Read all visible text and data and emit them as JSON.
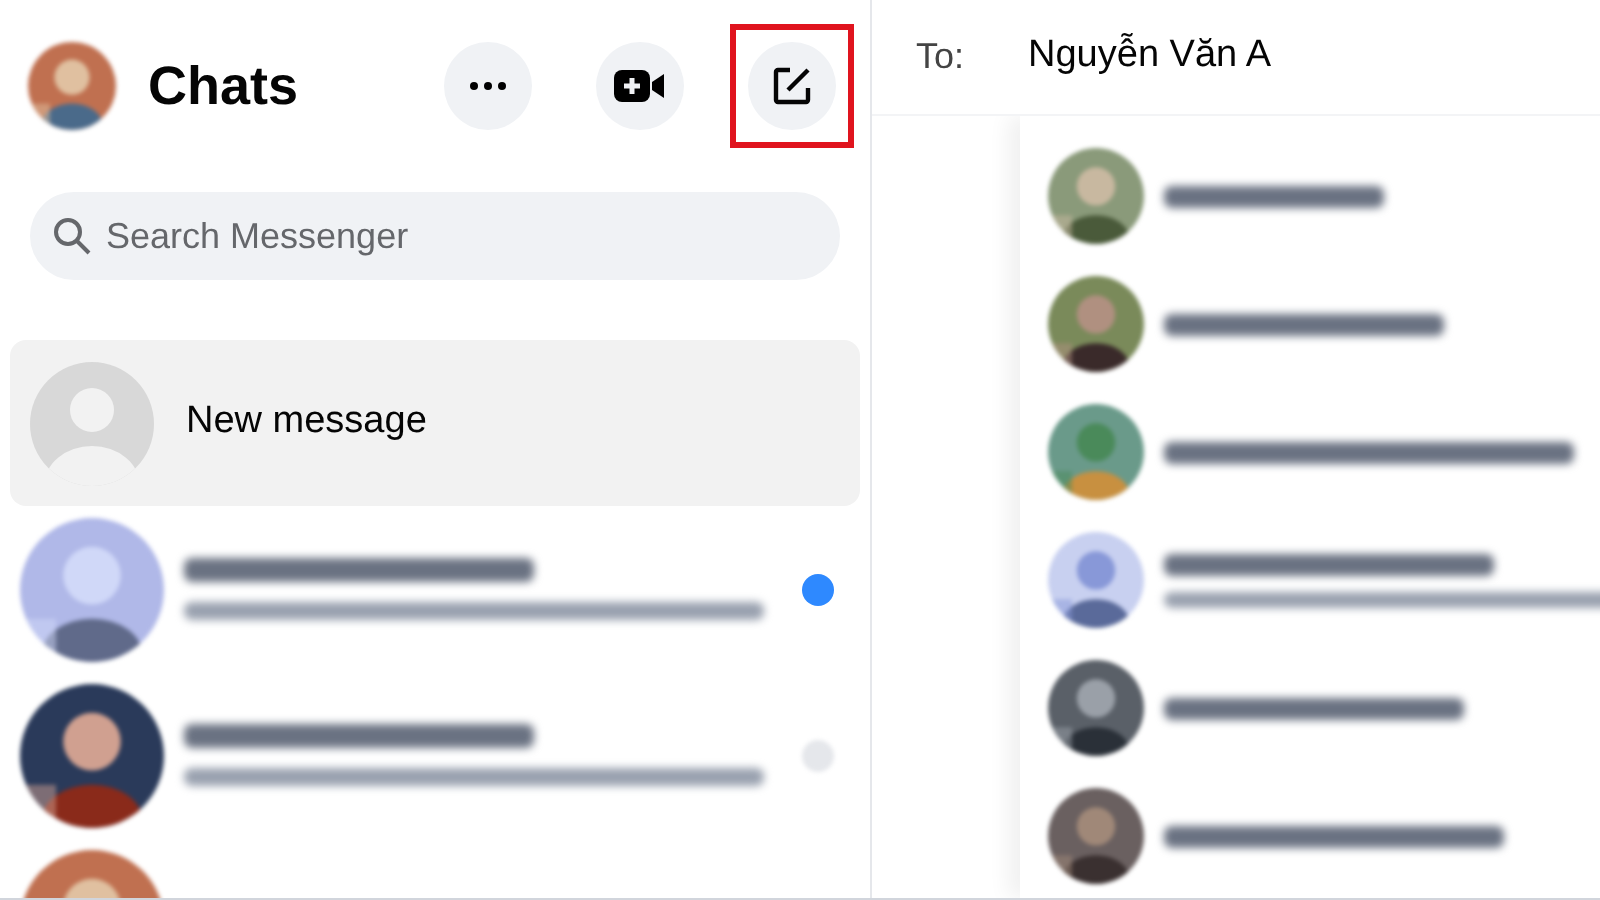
{
  "sidebar": {
    "title": "Chats",
    "actions": [
      {
        "kind": "more",
        "highlighted": false
      },
      {
        "kind": "video",
        "highlighted": false
      },
      {
        "kind": "compose",
        "highlighted": true
      }
    ],
    "search": {
      "placeholder": "Search Messenger"
    },
    "new_message": {
      "label": "New message"
    },
    "chats": [
      {
        "kind": "conversation",
        "unread": true
      },
      {
        "kind": "conversation",
        "unread": false
      },
      {
        "kind": "peek"
      }
    ]
  },
  "compose": {
    "to_label": "To:",
    "value": "Nguyễn Văn A",
    "suggestions": [
      {
        "kind": "person"
      },
      {
        "kind": "person"
      },
      {
        "kind": "person"
      },
      {
        "kind": "group"
      },
      {
        "kind": "person"
      },
      {
        "kind": "person"
      }
    ]
  }
}
